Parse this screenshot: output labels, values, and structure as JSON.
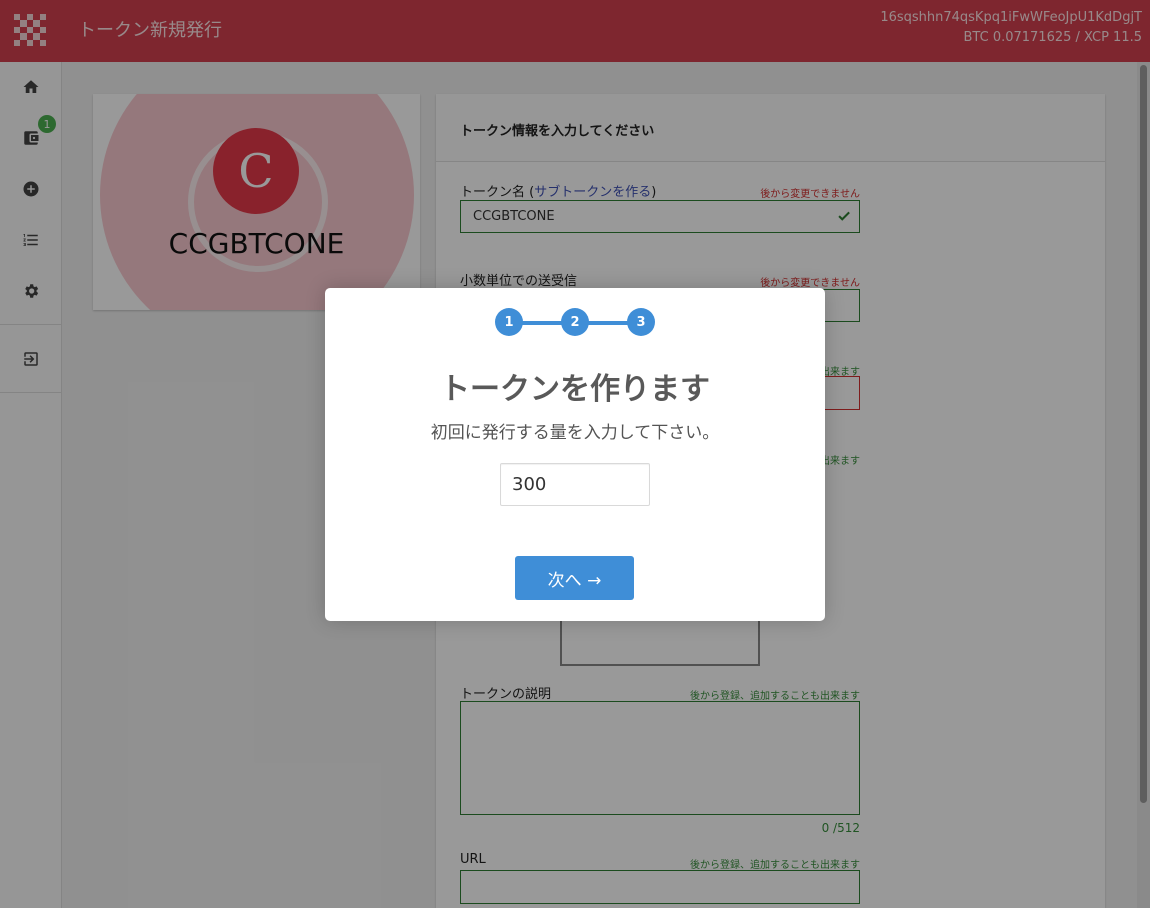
{
  "header": {
    "title": "トークン新規発行",
    "address": "16sqshhn74qsKpq1iFwWFeoJpU1KdDgjT",
    "balance": "BTC 0.07171625 / XCP 11.5"
  },
  "sidebar": {
    "items": [
      {
        "icon": "home-icon"
      },
      {
        "icon": "wallet-icon",
        "badge": "1"
      },
      {
        "icon": "add-circle-icon"
      },
      {
        "icon": "list-icon"
      },
      {
        "icon": "gear-icon"
      },
      {
        "icon": "logout-icon"
      }
    ]
  },
  "preview": {
    "initial": "C",
    "token_name": "CCGBTCONE"
  },
  "form": {
    "title": "トークン情報を入力してください",
    "token_name_label": "トークン名",
    "subtoken_link": "サブトークンを作る",
    "token_name_note": "後から変更できません",
    "token_name_value": "CCGBTCONE",
    "divisible_label": "小数単位での送受信",
    "divisible_note": "後から変更できません",
    "note_partial_1": "出来ます",
    "note_partial_2": "出来ます",
    "description_label": "トークンの説明",
    "description_note": "後から登録、追加することも出来ます",
    "description_counter": "0 /512",
    "url_label": "URL",
    "url_note": "後から登録、追加することも出来ます"
  },
  "modal": {
    "steps": [
      "1",
      "2",
      "3"
    ],
    "title": "トークンを作ります",
    "text": "初回に発行する量を入力して下さい。",
    "amount_value": "300",
    "next_label": "次へ →"
  },
  "colors": {
    "header": "#d2404f",
    "accent": "#3f8ed7",
    "valid": "#2e7d32",
    "error": "#d32f2f"
  }
}
